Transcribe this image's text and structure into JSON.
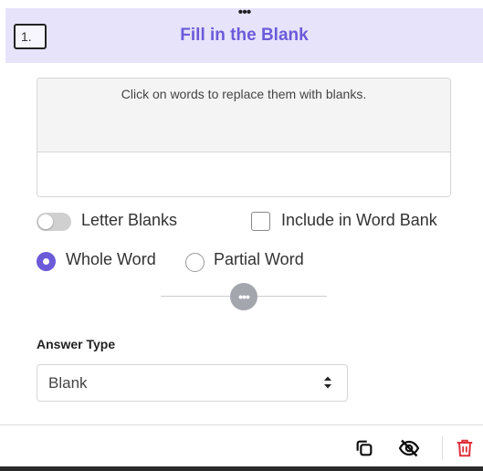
{
  "header": {
    "drag_handle": "•••",
    "question_number": "1.",
    "title": "Fill in the Blank"
  },
  "editor": {
    "instructions": "Click on words to replace them with blanks.",
    "content": ""
  },
  "options": {
    "letter_blanks_label": "Letter Blanks",
    "letter_blanks_on": false,
    "include_word_bank_label": "Include in Word Bank",
    "include_word_bank_checked": false,
    "whole_word_label": "Whole Word",
    "partial_word_label": "Partial Word",
    "selected_mode": "Whole Word"
  },
  "more_button": {
    "label": "•••"
  },
  "answer_type": {
    "label": "Answer Type",
    "selected_value": "Blank"
  },
  "toolbar": {
    "icons": [
      "copy-icon",
      "hide-icon",
      "trash-icon"
    ]
  },
  "colors": {
    "accent": "#6b5bd9",
    "header_bg": "#e6e3fb",
    "delete": "#e0303a"
  }
}
